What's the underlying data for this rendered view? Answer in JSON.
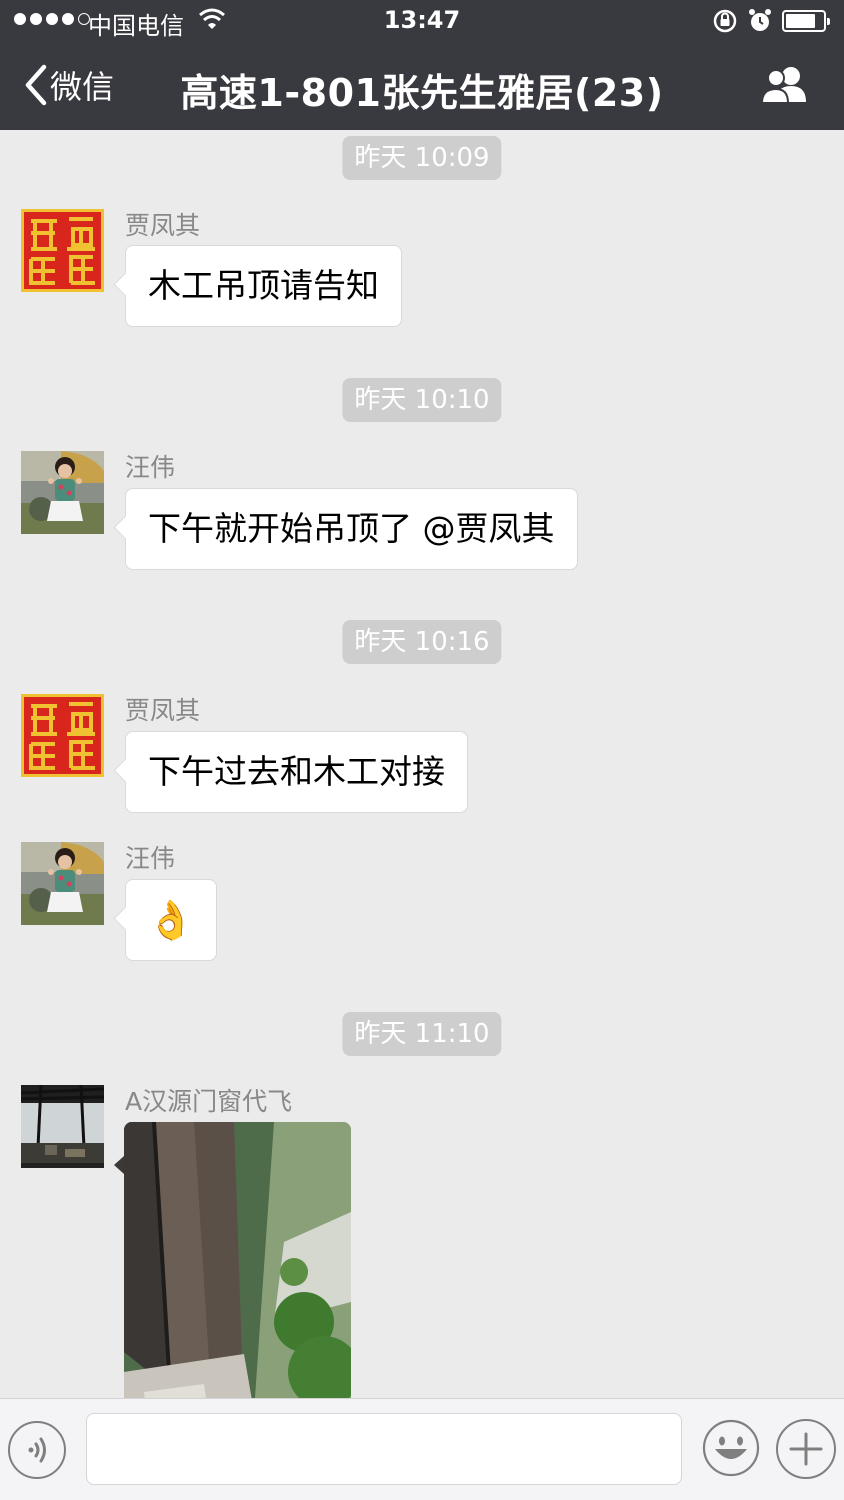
{
  "status_bar": {
    "carrier": "中国电信",
    "time": "13:47",
    "battery_level": 0.8,
    "signal_bars": 4
  },
  "nav": {
    "back_label": "微信",
    "title": "高速1-801张先生雅居(23)"
  },
  "messages": [
    {
      "timestamp": "昨天 10:09",
      "sender": "贾凤其",
      "text": "木工吊顶请告知"
    },
    {
      "timestamp": "昨天 10:10",
      "sender": "汪伟",
      "text": "下午就开始吊顶了  @贾凤其"
    },
    {
      "timestamp": "昨天 10:16",
      "sender": "贾凤其",
      "text": "下午过去和木工对接"
    },
    {
      "sender": "汪伟",
      "emoji": "👌"
    },
    {
      "timestamp": "昨天 11:10",
      "sender": "A汉源门窗代飞",
      "image": "building-facade-photo"
    }
  ],
  "input_bar": {
    "placeholder": "",
    "icons": [
      "voice-icon",
      "emoji-icon",
      "plus-icon"
    ]
  },
  "colors": {
    "nav_bg": "#393a3f",
    "chat_bg": "#ebebeb",
    "timestamp_bg": "#cecece",
    "seal_red": "#d9261c",
    "seal_gold": "#f0c232"
  }
}
